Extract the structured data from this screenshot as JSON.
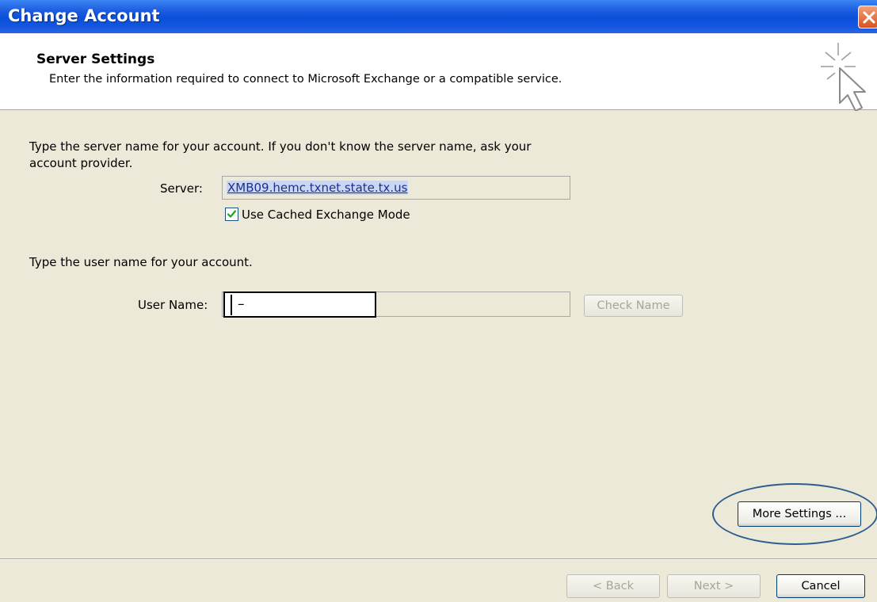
{
  "window": {
    "title": "Change Account"
  },
  "header": {
    "title": "Server Settings",
    "subtitle": "Enter the information required to connect to Microsoft Exchange or a compatible service."
  },
  "server_section": {
    "instructions_line1": "Type the server name for your account. If you don't know the server name, ask your",
    "instructions_line2": "account provider.",
    "server_label": "Server:",
    "server_value": "XMB09.hemc.txnet.state.tx.us",
    "cached_mode_label": "Use Cached Exchange Mode",
    "cached_mode_checked": true
  },
  "user_section": {
    "instructions": "Type the user name for your account.",
    "username_label": "User Name:",
    "username_value": "–",
    "check_name_label": "Check Name"
  },
  "buttons": {
    "more_settings": "More Settings ...",
    "back": "< Back",
    "next": "Next >",
    "cancel": "Cancel"
  },
  "icons": {
    "close": "close-icon",
    "wizard": "wizard-cursor-icon",
    "check": "checkmark-icon"
  },
  "colors": {
    "titlebar": "#0A4FDA",
    "dialog_bg": "#ECE9D8",
    "close_button": "#D8521F",
    "highlight_ring": "#2E5D8F"
  }
}
